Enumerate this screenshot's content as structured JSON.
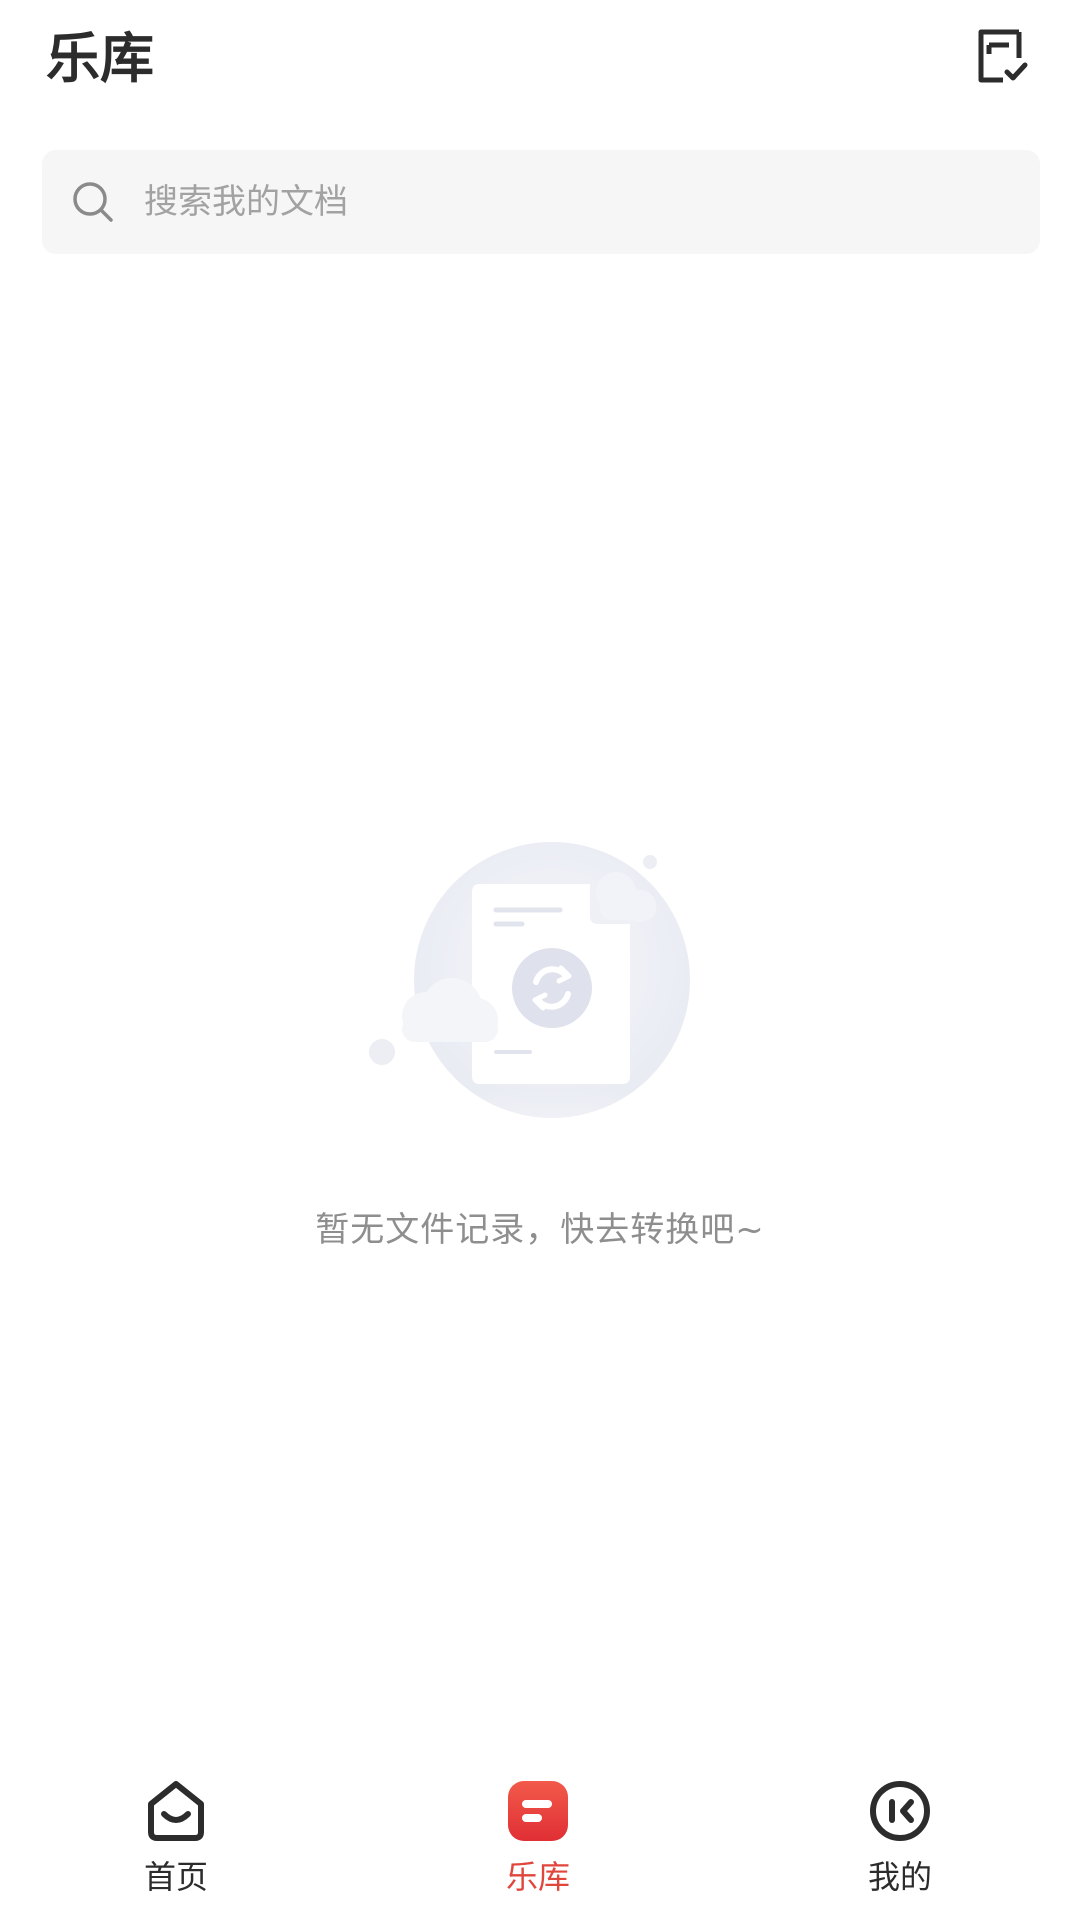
{
  "header": {
    "title": "乐库",
    "edit_icon": "checklist-edit-icon"
  },
  "search": {
    "placeholder": "搜索我的文档",
    "value": "",
    "icon": "search-icon"
  },
  "empty_state": {
    "message": "暂无文件记录，快去转换吧~",
    "icon": "document-convert-illustration"
  },
  "bottom_nav": {
    "items": [
      {
        "label": "首页",
        "icon": "home-icon",
        "active": false
      },
      {
        "label": "乐库",
        "icon": "library-icon",
        "active": true
      },
      {
        "label": "我的",
        "icon": "profile-icon",
        "active": false
      }
    ]
  },
  "colors": {
    "accent": "#e0463b",
    "text_primary": "#2c2c2c",
    "text_muted": "#8e8e8e",
    "search_bg": "#f6f6f6"
  }
}
